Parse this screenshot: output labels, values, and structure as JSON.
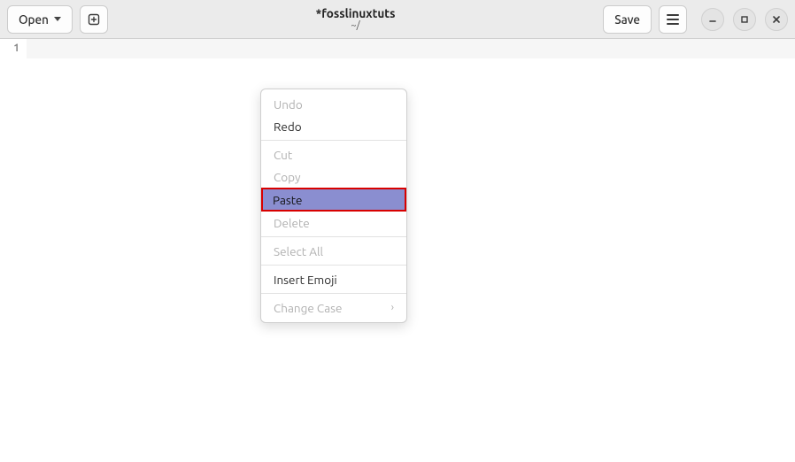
{
  "header": {
    "open_label": "Open",
    "save_label": "Save",
    "title": "*fosslinuxtuts",
    "subtitle": "~/"
  },
  "editor": {
    "line_number_1": "1"
  },
  "context_menu": {
    "undo": "Undo",
    "redo": "Redo",
    "cut": "Cut",
    "copy": "Copy",
    "paste": "Paste",
    "delete": "Delete",
    "select_all": "Select All",
    "insert_emoji": "Insert Emoji",
    "change_case": "Change Case"
  }
}
